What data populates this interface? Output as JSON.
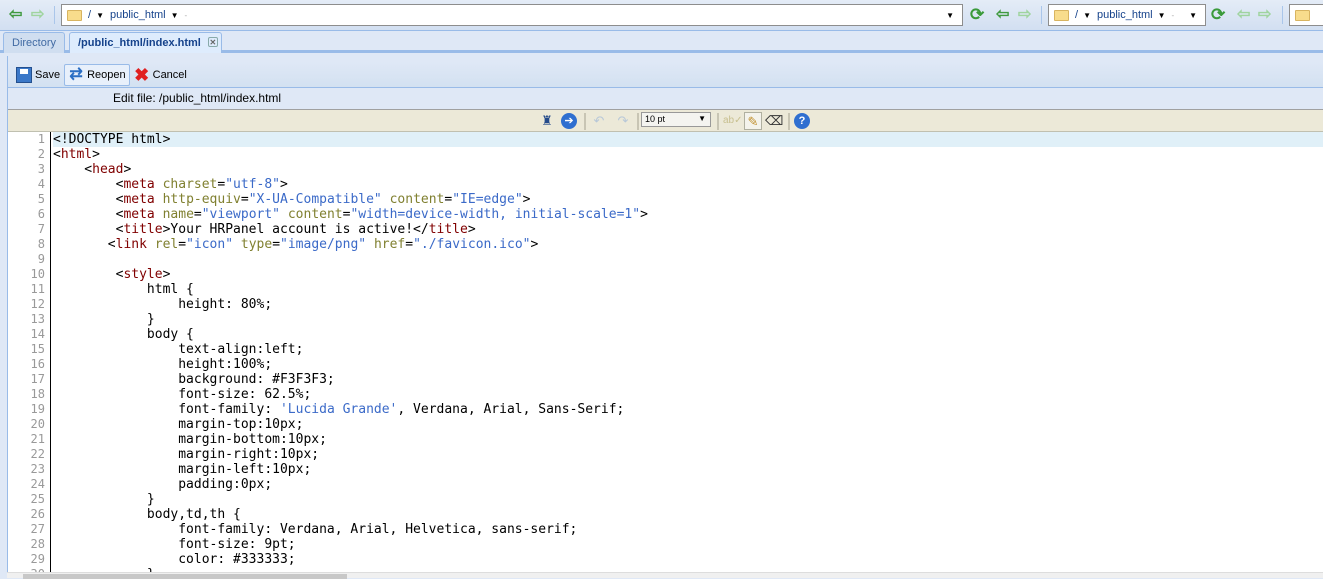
{
  "topbar": {
    "left_path": {
      "root": "/",
      "folder": "public_html"
    },
    "right_path": {
      "root": "/",
      "folder": "public_html"
    },
    "icons": [
      "back-arrow-icon",
      "forward-arrow-icon",
      "folder-icon",
      "refresh-icon"
    ]
  },
  "tabs": [
    {
      "label": "Directory",
      "active": false
    },
    {
      "label": "/public_html/index.html",
      "active": true,
      "closable": true
    }
  ],
  "panel_toolbar": {
    "save": "Save",
    "reopen": "Reopen",
    "cancel": "Cancel"
  },
  "edit_file_label": "Edit file: /public_html/index.html",
  "editor_toolbar": {
    "font_size": "10 pt",
    "icons": [
      "find-icon",
      "goto-icon",
      "undo-icon",
      "redo-icon",
      "spellcheck-icon",
      "highlight-icon",
      "eraser-icon",
      "help-icon"
    ]
  },
  "colors": {
    "tag": "#800000",
    "attribute": "#808030",
    "string": "#3b6ac8",
    "current_line": "#e0f0f8"
  },
  "code_lines": [
    [
      [
        "p",
        "<!DOCTYPE html>"
      ]
    ],
    [
      [
        "p",
        "<"
      ],
      [
        "tag",
        "html"
      ],
      [
        "p",
        ">"
      ]
    ],
    [
      [
        "p",
        "    <"
      ],
      [
        "tag",
        "head"
      ],
      [
        "p",
        ">"
      ]
    ],
    [
      [
        "p",
        "        <"
      ],
      [
        "tag",
        "meta"
      ],
      [
        "p",
        " "
      ],
      [
        "attr",
        "charset"
      ],
      [
        "p",
        "="
      ],
      [
        "str",
        "\"utf-8\""
      ],
      [
        "p",
        ">"
      ]
    ],
    [
      [
        "p",
        "        <"
      ],
      [
        "tag",
        "meta"
      ],
      [
        "p",
        " "
      ],
      [
        "attr",
        "http-equiv"
      ],
      [
        "p",
        "="
      ],
      [
        "str",
        "\"X-UA-Compatible\""
      ],
      [
        "p",
        " "
      ],
      [
        "attr",
        "content"
      ],
      [
        "p",
        "="
      ],
      [
        "str",
        "\"IE=edge\""
      ],
      [
        "p",
        ">"
      ]
    ],
    [
      [
        "p",
        "        <"
      ],
      [
        "tag",
        "meta"
      ],
      [
        "p",
        " "
      ],
      [
        "attr",
        "name"
      ],
      [
        "p",
        "="
      ],
      [
        "str",
        "\"viewport\""
      ],
      [
        "p",
        " "
      ],
      [
        "attr",
        "content"
      ],
      [
        "p",
        "="
      ],
      [
        "str",
        "\"width=device-width, initial-scale=1\""
      ],
      [
        "p",
        ">"
      ]
    ],
    [
      [
        "p",
        "        <"
      ],
      [
        "tag",
        "title"
      ],
      [
        "p",
        ">Your HRPanel account is active!</"
      ],
      [
        "tag",
        "title"
      ],
      [
        "p",
        ">"
      ]
    ],
    [
      [
        "p",
        "       <"
      ],
      [
        "tag",
        "link"
      ],
      [
        "p",
        " "
      ],
      [
        "attr",
        "rel"
      ],
      [
        "p",
        "="
      ],
      [
        "str",
        "\"icon\""
      ],
      [
        "p",
        " "
      ],
      [
        "attr",
        "type"
      ],
      [
        "p",
        "="
      ],
      [
        "str",
        "\"image/png\""
      ],
      [
        "p",
        " "
      ],
      [
        "attr",
        "href"
      ],
      [
        "p",
        "="
      ],
      [
        "str",
        "\"./favicon.ico\""
      ],
      [
        "p",
        ">"
      ]
    ],
    [
      [
        "p",
        ""
      ]
    ],
    [
      [
        "p",
        "        <"
      ],
      [
        "tag",
        "style"
      ],
      [
        "p",
        ">"
      ]
    ],
    [
      [
        "p",
        "            html {"
      ]
    ],
    [
      [
        "p",
        "                height: 80%;"
      ]
    ],
    [
      [
        "p",
        "            }"
      ]
    ],
    [
      [
        "p",
        "            body {"
      ]
    ],
    [
      [
        "p",
        "                text-align:left;"
      ]
    ],
    [
      [
        "p",
        "                height:100%;"
      ]
    ],
    [
      [
        "p",
        "                background: #F3F3F3;"
      ]
    ],
    [
      [
        "p",
        "                font-size: 62.5%;"
      ]
    ],
    [
      [
        "p",
        "                font-family: "
      ],
      [
        "str",
        "'Lucida Grande'"
      ],
      [
        "p",
        ", Verdana, Arial, Sans-Serif;"
      ]
    ],
    [
      [
        "p",
        "                margin-top:10px;"
      ]
    ],
    [
      [
        "p",
        "                margin-bottom:10px;"
      ]
    ],
    [
      [
        "p",
        "                margin-right:10px;"
      ]
    ],
    [
      [
        "p",
        "                margin-left:10px;"
      ]
    ],
    [
      [
        "p",
        "                padding:0px;"
      ]
    ],
    [
      [
        "p",
        "            }"
      ]
    ],
    [
      [
        "p",
        "            body,td,th {"
      ]
    ],
    [
      [
        "p",
        "                font-family: Verdana, Arial, Helvetica, sans-serif;"
      ]
    ],
    [
      [
        "p",
        "                font-size: 9pt;"
      ]
    ],
    [
      [
        "p",
        "                color: #333333;"
      ]
    ],
    [
      [
        "p",
        "            }"
      ]
    ]
  ]
}
